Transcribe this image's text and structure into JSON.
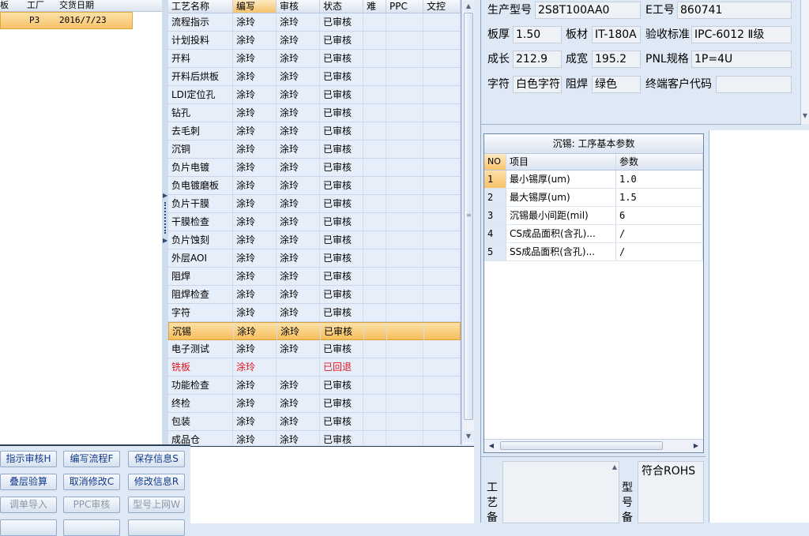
{
  "left_panel": {
    "headers": [
      "板",
      "工厂",
      "交货日期"
    ],
    "row": {
      "factory": "P3",
      "date": "2016/7/23"
    }
  },
  "process_grid": {
    "headers": [
      "工艺名称",
      "编写",
      "审核",
      "状态",
      "难",
      "PPC",
      "文控"
    ],
    "rows": [
      {
        "name": "流程指示",
        "writer": "涂玲",
        "reviewer": "涂玲",
        "status": "已审核"
      },
      {
        "name": "计划投料",
        "writer": "涂玲",
        "reviewer": "涂玲",
        "status": "已审核"
      },
      {
        "name": "开料",
        "writer": "涂玲",
        "reviewer": "涂玲",
        "status": "已审核"
      },
      {
        "name": "开料后烘板",
        "writer": "涂玲",
        "reviewer": "涂玲",
        "status": "已审核"
      },
      {
        "name": "LDI定位孔",
        "writer": "涂玲",
        "reviewer": "涂玲",
        "status": "已审核"
      },
      {
        "name": "钻孔",
        "writer": "涂玲",
        "reviewer": "涂玲",
        "status": "已审核"
      },
      {
        "name": "去毛刺",
        "writer": "涂玲",
        "reviewer": "涂玲",
        "status": "已审核"
      },
      {
        "name": "沉铜",
        "writer": "涂玲",
        "reviewer": "涂玲",
        "status": "已审核"
      },
      {
        "name": "负片电镀",
        "writer": "涂玲",
        "reviewer": "涂玲",
        "status": "已审核"
      },
      {
        "name": "负电镀磨板",
        "writer": "涂玲",
        "reviewer": "涂玲",
        "status": "已审核"
      },
      {
        "name": "负片干膜",
        "writer": "涂玲",
        "reviewer": "涂玲",
        "status": "已审核"
      },
      {
        "name": "干膜检查",
        "writer": "涂玲",
        "reviewer": "涂玲",
        "status": "已审核"
      },
      {
        "name": "负片蚀刻",
        "writer": "涂玲",
        "reviewer": "涂玲",
        "status": "已审核"
      },
      {
        "name": "外层AOI",
        "writer": "涂玲",
        "reviewer": "涂玲",
        "status": "已审核"
      },
      {
        "name": "阻焊",
        "writer": "涂玲",
        "reviewer": "涂玲",
        "status": "已审核"
      },
      {
        "name": "阻焊检查",
        "writer": "涂玲",
        "reviewer": "涂玲",
        "status": "已审核"
      },
      {
        "name": "字符",
        "writer": "涂玲",
        "reviewer": "涂玲",
        "status": "已审核"
      },
      {
        "name": "沉锡",
        "writer": "涂玲",
        "reviewer": "涂玲",
        "status": "已审核"
      },
      {
        "name": "电子测试",
        "writer": "涂玲",
        "reviewer": "涂玲",
        "status": "已审核"
      },
      {
        "name": "铣板",
        "writer": "涂玲",
        "reviewer": "",
        "status": "已回退"
      },
      {
        "name": "功能检查",
        "writer": "涂玲",
        "reviewer": "涂玲",
        "status": "已审核"
      },
      {
        "name": "终检",
        "writer": "涂玲",
        "reviewer": "涂玲",
        "status": "已审核"
      },
      {
        "name": "包装",
        "writer": "涂玲",
        "reviewer": "涂玲",
        "status": "已审核"
      },
      {
        "name": "成品仓",
        "writer": "涂玲",
        "reviewer": "涂玲",
        "status": "已审核"
      }
    ],
    "selected_index": 17,
    "returned_index": 19
  },
  "buttons": {
    "review_instruction": "指示审核H",
    "write_process": "编写流程F",
    "save_info": "保存信息S",
    "stack_verify": "叠层验算",
    "cancel_modify": "取消修改C",
    "modify_info": "修改信息R",
    "import_order": "调单导入",
    "ppc_review": "PPC审核",
    "model_upload": "型号上网W"
  },
  "info": {
    "model_label": "生产型号",
    "model_value": "2S8T100AA0",
    "e_no_label": "E工号",
    "e_no_value": "860741",
    "thickness_label": "板厚",
    "thickness_value": "1.50",
    "material_label": "板材",
    "material_value": "IT-180A",
    "standard_label": "验收标准",
    "standard_value": "IPC-6012 Ⅱ级",
    "length_label": "成长",
    "length_value": "212.9",
    "width_label": "成宽",
    "width_value": "195.2",
    "pnl_label": "PNL规格",
    "pnl_value": "1P=4U",
    "char_label": "字符",
    "char_value": "白色字符",
    "mask_label": "阻焊",
    "mask_value": "绿色",
    "customer_label": "终端客户代码",
    "customer_value": ""
  },
  "params": {
    "title": "沉锡: 工序基本参数",
    "headers": [
      "NO",
      "项目",
      "参数"
    ],
    "rows": [
      {
        "no": "1",
        "item": "最小锡厚(um)",
        "value": "1.0"
      },
      {
        "no": "2",
        "item": "最大锡厚(um)",
        "value": "1.5"
      },
      {
        "no": "3",
        "item": "沉锡最小间距(mil)",
        "value": "6"
      },
      {
        "no": "4",
        "item": "CS成品面积(含孔)...",
        "value": "/"
      },
      {
        "no": "5",
        "item": "SS成品面积(含孔)...",
        "value": "/"
      }
    ]
  },
  "remarks": {
    "process_label": "工艺备",
    "model_label": "型号备",
    "model_memo": "符合ROHS"
  }
}
